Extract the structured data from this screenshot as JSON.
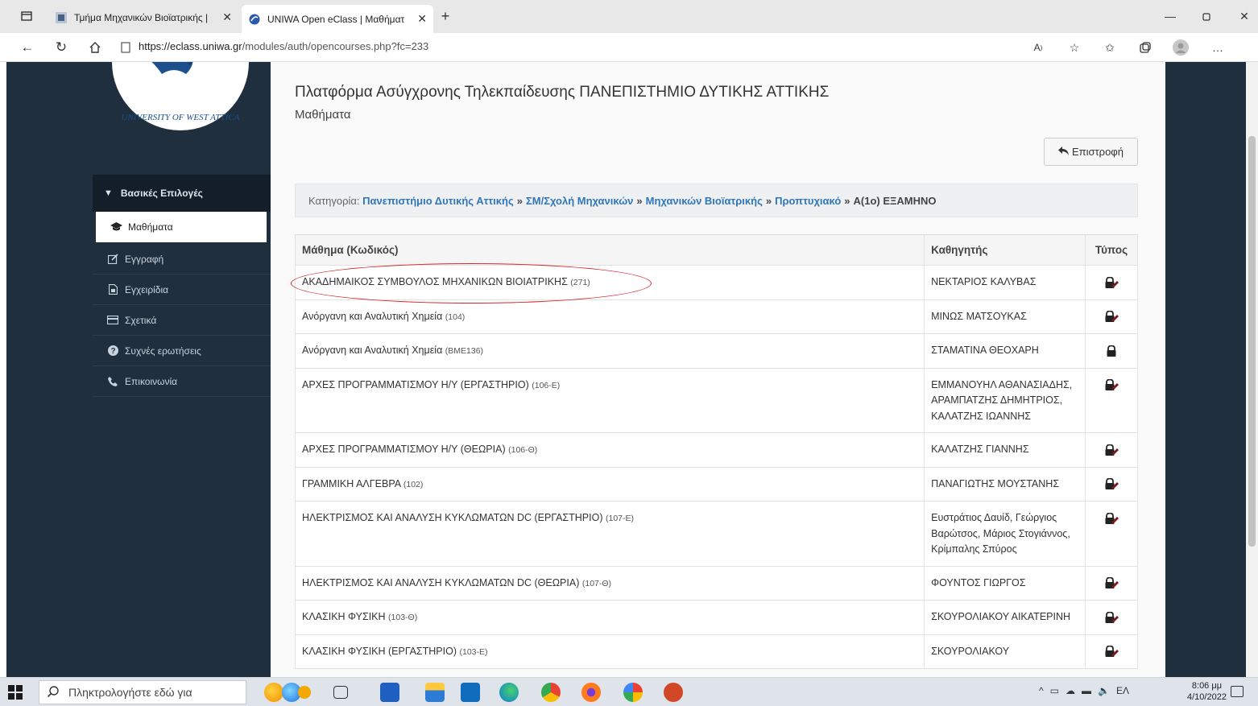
{
  "browser": {
    "tabs": [
      {
        "label": "Τμήμα Μηχανικών Βιοϊατρικής |",
        "active": false
      },
      {
        "label": "UNIWA Open eClass | Μαθήματ",
        "active": true
      }
    ],
    "url_host": "https://eclass.uniwa.gr",
    "url_path": "/modules/auth/opencourses.php?fc=233"
  },
  "sidebar": {
    "logo_text": "UNIVERSITY OF WEST ATTICA",
    "section_label": "Βασικές Επιλογές",
    "items": [
      {
        "label": "Μαθήματα",
        "icon": "graduation-cap-icon",
        "active": true
      },
      {
        "label": "Εγγραφή",
        "icon": "edit-icon",
        "active": false
      },
      {
        "label": "Εγχειρίδια",
        "icon": "file-icon",
        "active": false
      },
      {
        "label": "Σχετικά",
        "icon": "credit-card-icon",
        "active": false
      },
      {
        "label": "Συχνές ερωτήσεις",
        "icon": "question-circle-icon",
        "active": false
      },
      {
        "label": "Επικοινωνία",
        "icon": "phone-icon",
        "active": false
      }
    ]
  },
  "main": {
    "title": "Πλατφόρμα Ασύγχρονης Τηλεκπαίδευσης ΠΑΝΕΠΙΣΤΗΜΙΟ ΔΥΤΙΚΗΣ ΑΤΤΙΚΗΣ",
    "subtitle": "Μαθήματα",
    "back_label": "Επιστροφή",
    "breadcrumb": {
      "prefix": "Κατηγορία:",
      "links": [
        "Πανεπιστήμιο Δυτικής Αττικής",
        "ΣΜ/Σχολή Μηχανικών",
        "Μηχανικών Βιοϊατρικής",
        "Προπτυχιακό"
      ],
      "separator": "»",
      "current": "Α(1ο) ΕΞΑΜΗΝΟ"
    },
    "table": {
      "headers": [
        "Μάθημα (Κωδικός)",
        "Καθηγητής",
        "Τύπος"
      ],
      "rows": [
        {
          "course": "ΑΚΑΔΗΜΑΙΚΟΣ ΣΥΜΒΟΥΛΟΣ ΜΗΧΑΝΙΚΩΝ ΒΙΟΙΑΤΡΙΚΗΣ",
          "code": "(271)",
          "teacher": "ΝΕΚΤΑΡΙΟΣ ΚΑΛΥΒΑΣ",
          "type": "lock-pencil-icon"
        },
        {
          "course": "Ανόργανη και Αναλυτική Χημεία",
          "code": "(104)",
          "teacher": "ΜΙΝΩΣ ΜΑΤΣΟΥΚΑΣ",
          "type": "lock-pencil-icon"
        },
        {
          "course": "Ανόργανη και Αναλυτική Χημεία",
          "code": "(BME136)",
          "teacher": "ΣΤΑΜΑΤΙΝΑ ΘΕΟΧΑΡΗ",
          "type": "lock-icon"
        },
        {
          "course": "ΑΡΧΕΣ ΠΡΟΓΡΑΜΜΑΤΙΣΜΟΥ Η/Υ (ΕΡΓΑΣΤΗΡΙΟ)",
          "code": "(106-Ε)",
          "teacher": "ΕΜΜΑΝΟΥΗΛ ΑΘΑΝΑΣΙΑΔΗΣ, ΑΡΑΜΠΑΤΖΗΣ ΔΗΜΗΤΡΙΟΣ, ΚΑΛΑΤΖΗΣ ΙΩΑΝΝΗΣ",
          "type": "lock-pencil-icon"
        },
        {
          "course": "ΑΡΧΕΣ ΠΡΟΓΡΑΜΜΑΤΙΣΜΟΥ Η/Υ (ΘΕΩΡΙΑ)",
          "code": "(106-Θ)",
          "teacher": "ΚΑΛΑΤΖΗΣ ΓΙΑΝΝΗΣ",
          "type": "lock-pencil-icon"
        },
        {
          "course": "ΓΡΑΜΜΙΚΗ ΑΛΓΕΒΡΑ",
          "code": "(102)",
          "teacher": "ΠΑΝΑΓΙΩΤΗΣ ΜΟΥΣΤΑΝΗΣ",
          "type": "lock-pencil-icon"
        },
        {
          "course": "ΗΛΕΚΤΡΙΣΜΟΣ ΚΑΙ ΑΝΑΛΥΣΗ ΚΥΚΛΩΜΑΤΩΝ DC (ΕΡΓΑΣΤΗΡΙΟ)",
          "code": "(107-Ε)",
          "teacher": "Ευστράτιος Δαυίδ, Γεώργιος Βαρώτσος, Μάριος Στογιάννος, Κρίμπαλης Σπύρος",
          "type": "lock-pencil-icon"
        },
        {
          "course": "ΗΛΕΚΤΡΙΣΜΟΣ ΚΑΙ ΑΝΑΛΥΣΗ ΚΥΚΛΩΜΑΤΩΝ DC (ΘΕΩΡΙΑ)",
          "code": "(107-Θ)",
          "teacher": "ΦΟΥΝΤΟΣ ΓΙΩΡΓΟΣ",
          "type": "lock-pencil-icon"
        },
        {
          "course": "ΚΛΑΣΙΚΗ ΦΥΣΙΚΗ",
          "code": "(103-Θ)",
          "teacher": "ΣΚΟΥΡΟΛΙΑΚΟΥ ΑΙΚΑΤΕΡΙΝΗ",
          "type": "lock-pencil-icon"
        },
        {
          "course": "ΚΛΑΣΙΚΗ ΦΥΣΙΚΗ (ΕΡΓΑΣΤΗΡΙΟ)",
          "code": "(103-Ε)",
          "teacher": "ΣΚΟΥΡΟΛΙΑΚΟΥ",
          "type": "lock-pencil-icon"
        }
      ]
    }
  },
  "taskbar": {
    "search_placeholder": "Πληκτρολογήστε εδώ για",
    "language": "ΕΛ",
    "time": "8:06 μμ",
    "date": "4/10/2022"
  },
  "colors": {
    "sidebar_bg": "#1f2f3d",
    "link_blue": "#2f76bb",
    "annotation_red": "#d9262c"
  }
}
